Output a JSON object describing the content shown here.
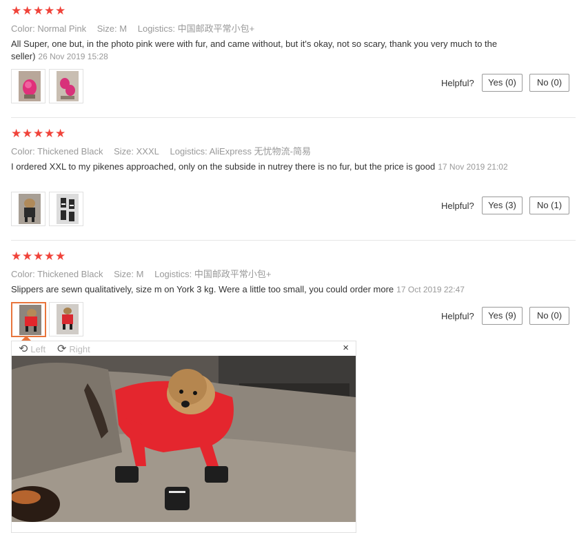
{
  "colors": {
    "star": "#f0433a",
    "accent_border": "#e8743b",
    "muted_text": "#999999",
    "body_text": "#333333"
  },
  "reviews": [
    {
      "stars": [
        "★",
        "★",
        "★",
        "★",
        "★"
      ],
      "color_label": "Color:",
      "color_value": "Normal Pink",
      "size_label": "Size:",
      "size_value": "M",
      "logistics_label": "Logistics:",
      "logistics_value": "中国邮政平常小包+",
      "text": "All Super, one but, in the photo pink were with fur, and came without, but it's okay, not so scary, thank you very much to the seller)",
      "date": "26 Nov 2019 15:28",
      "helpful_label": "Helpful?",
      "yes_label": "Yes (0)",
      "no_label": "No (0)"
    },
    {
      "stars": [
        "★",
        "★",
        "★",
        "★",
        "★"
      ],
      "color_label": "Color:",
      "color_value": "Thickened Black",
      "size_label": "Size:",
      "size_value": "XXXL",
      "logistics_label": "Logistics:",
      "logistics_value": "AliExpress 无忧物流-简易",
      "text": "I ordered XXL to my pikenes approached, only on the subside in nutrey there is no fur, but the price is good",
      "date": "17 Nov 2019 21:02",
      "helpful_label": "Helpful?",
      "yes_label": "Yes (3)",
      "no_label": "No (1)"
    },
    {
      "stars": [
        "★",
        "★",
        "★",
        "★",
        "★"
      ],
      "color_label": "Color:",
      "color_value": "Thickened Black",
      "size_label": "Size:",
      "size_value": "M",
      "logistics_label": "Logistics:",
      "logistics_value": "中国邮政平常小包+",
      "text": "Slippers are sewn qualitatively, size m on York 3 kg. Were a little too small, you could order more",
      "date": "17 Oct 2019 22:47",
      "helpful_label": "Helpful?",
      "yes_label": "Yes (9)",
      "no_label": "No (0)"
    }
  ],
  "viewer": {
    "rotate_left_icon": "rotate-left-icon",
    "rotate_left_label": "Left",
    "rotate_right_icon": "rotate-right-icon",
    "rotate_right_label": "Right",
    "close_icon": "×"
  }
}
